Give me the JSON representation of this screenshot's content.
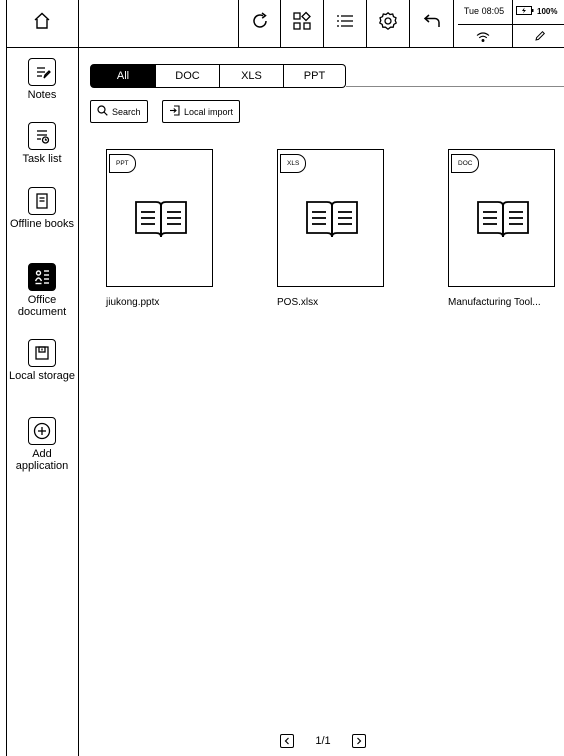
{
  "status": {
    "time": "Tue 08:05",
    "battery": "100%"
  },
  "toolbar": {
    "home_icon": "home-icon",
    "refresh_icon": "refresh-icon",
    "apps_icon": "apps-icon",
    "menu_icon": "menu-icon",
    "settings_icon": "settings-icon",
    "back_icon": "back-icon"
  },
  "sidebar": {
    "items": [
      {
        "label": "Notes",
        "icon": "notes-icon"
      },
      {
        "label": "Task list",
        "icon": "task-list-icon"
      },
      {
        "label": "Offline books",
        "icon": "offline-books-icon"
      },
      {
        "label": "Office document",
        "icon": "office-document-icon",
        "active": true
      },
      {
        "label": "Local storage",
        "icon": "local-storage-icon"
      },
      {
        "label": "Add application",
        "icon": "add-icon"
      }
    ]
  },
  "tabs": [
    {
      "label": "All",
      "active": true
    },
    {
      "label": "DOC"
    },
    {
      "label": "XLS"
    },
    {
      "label": "PPT"
    }
  ],
  "actions": {
    "search_label": "Search",
    "import_label": "Local import"
  },
  "files": [
    {
      "type": "PPT",
      "name": "jiukong.pptx"
    },
    {
      "type": "XLS",
      "name": "POS.xlsx"
    },
    {
      "type": "DOC",
      "name": "Manufacturing Tool..."
    }
  ],
  "pagination": {
    "text": "1/1"
  }
}
